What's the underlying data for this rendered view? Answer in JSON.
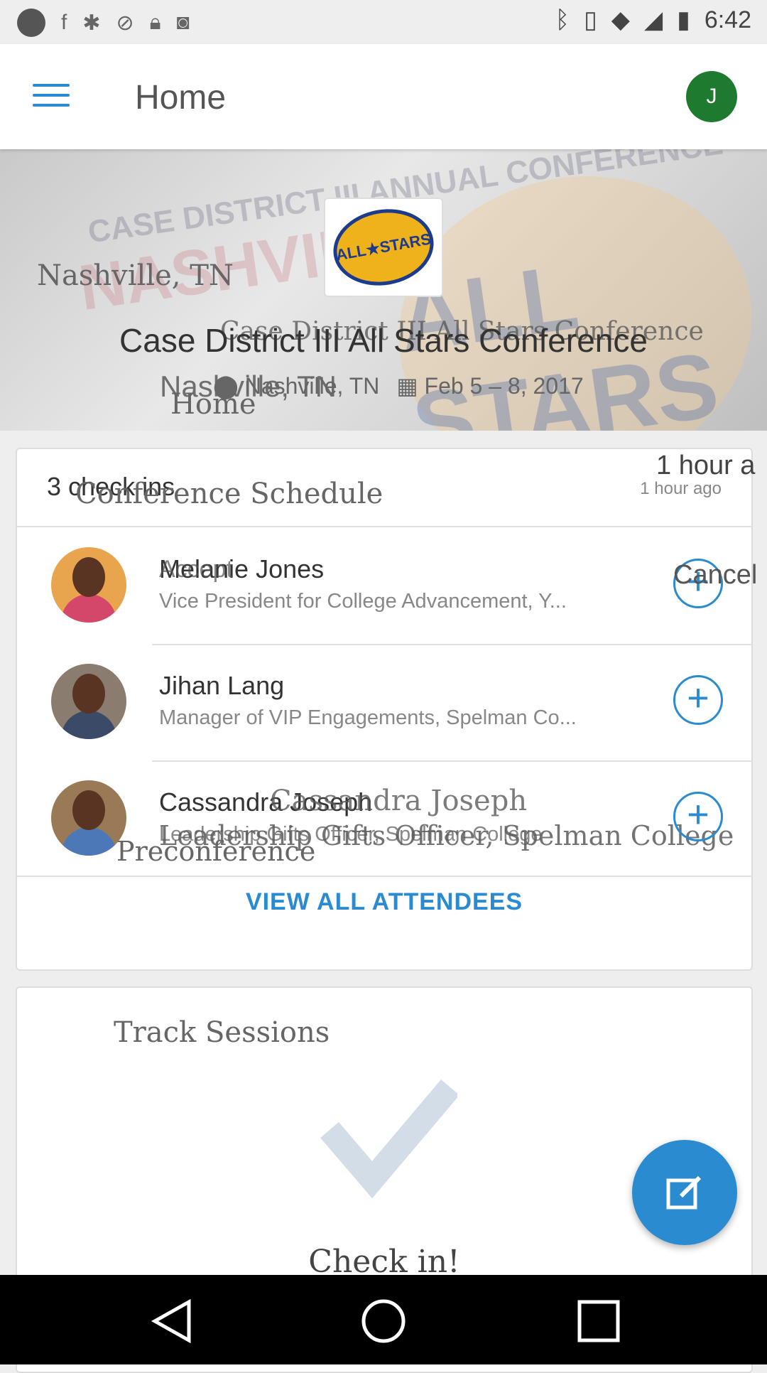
{
  "status_bar": {
    "time": "6:42"
  },
  "app_bar": {
    "title": "Home",
    "avatar_initial": "J"
  },
  "hero": {
    "background_text_1": "CASE DISTRICT III ANNUAL CONFERENCE",
    "background_text_2": "NASHVILLE",
    "background_text_3": "ALL STARS",
    "logo_text": "ALL★STARS",
    "location_ghost": "Nashville, TN",
    "title": "Case District III All Stars Conference",
    "title_ghost": "Case District III All Stars Conference",
    "location": "Nashville, TN",
    "location_ghost_large": "Nashville, TN",
    "dates": "Feb 5 – 8, 2017",
    "home_ghost": "Home"
  },
  "attendees_card": {
    "checkins": "3 check ins",
    "schedule_ghost": "Conference Schedule",
    "time_ago": "1 hour ago",
    "time_ago_ghost": "1 hour a",
    "people": [
      {
        "name": "Melanie Jones",
        "name_ghost": "Accept",
        "title": "Vice President for College Advancement, Y...",
        "photo_color": "#d4466a",
        "cancel_ghost": "Cancel"
      },
      {
        "name": "Jihan Lang",
        "title": "Manager of VIP Engagements, Spelman Co...",
        "photo_color": "#3b4a66"
      },
      {
        "name": "Cassandra Joseph",
        "name_ghost": "Cassandra Joseph",
        "title": "Leadership Gifts Officer, Spelman College",
        "title_ghost": "Leadership Gifts Officer, Spelman College",
        "preconference_ghost": "Preconference",
        "photo_color": "#4d78b8"
      }
    ],
    "view_all": "VIEW ALL ATTENDEES"
  },
  "track_card": {
    "label": "Track Sessions",
    "checkin": "Check in!"
  },
  "colors": {
    "accent": "#2a8bd0",
    "avatar": "#1e7a2e"
  }
}
